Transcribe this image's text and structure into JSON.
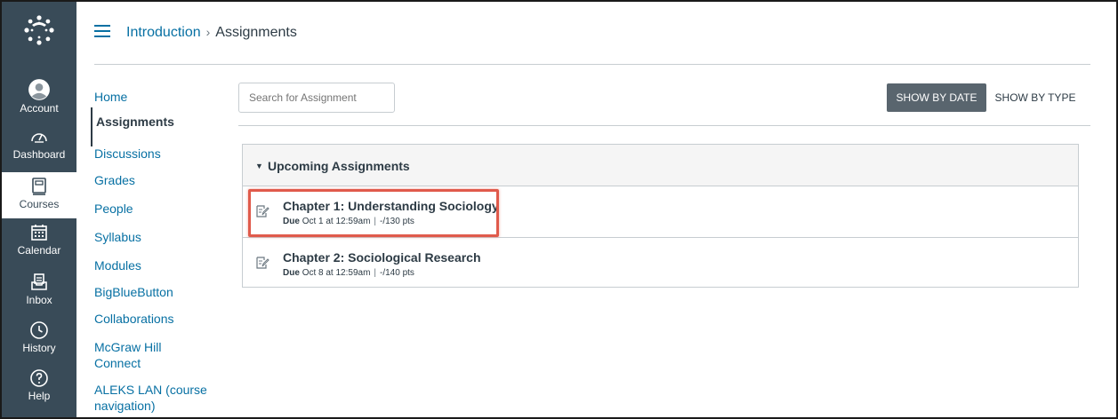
{
  "global_nav": {
    "items": [
      {
        "label": "Account",
        "icon": "account-icon"
      },
      {
        "label": "Dashboard",
        "icon": "dashboard-icon"
      },
      {
        "label": "Courses",
        "icon": "courses-icon"
      },
      {
        "label": "Calendar",
        "icon": "calendar-icon"
      },
      {
        "label": "Inbox",
        "icon": "inbox-icon"
      },
      {
        "label": "History",
        "icon": "history-icon"
      },
      {
        "label": "Help",
        "icon": "help-icon"
      }
    ],
    "active": "Courses",
    "colors": {
      "bg": "#394b58",
      "active_bg": "#ffffff"
    }
  },
  "breadcrumb": {
    "course": "Introduction",
    "separator": "›",
    "current": "Assignments"
  },
  "course_nav": {
    "items": [
      {
        "label": "Home"
      },
      {
        "label": "Assignments",
        "active": true
      },
      {
        "label": "Discussions"
      },
      {
        "label": "Grades"
      },
      {
        "label": "People"
      },
      {
        "label": "Syllabus"
      },
      {
        "label": "Modules"
      },
      {
        "label": "BigBlueButton"
      },
      {
        "label": "Collaborations"
      },
      {
        "label": "McGraw Hill\nConnect"
      },
      {
        "label": "ALEKS LAN (course\nnavigation)"
      }
    ]
  },
  "toolbar": {
    "search_placeholder": "Search for Assignment",
    "show_by_date": "SHOW BY DATE",
    "show_by_type": "SHOW BY TYPE"
  },
  "assignment_group": {
    "title": "Upcoming Assignments",
    "items": [
      {
        "title": "Chapter 1: Understanding Sociology",
        "due_label": "Due",
        "due": "Oct 1 at 12:59am",
        "points": "-/130 pts",
        "highlighted": true
      },
      {
        "title": "Chapter 2: Sociological Research",
        "due_label": "Due",
        "due": "Oct 8 at 12:59am",
        "points": "-/140 pts",
        "highlighted": false
      }
    ]
  },
  "colors": {
    "link": "#0770a3",
    "text": "#2d3b45",
    "highlight": "#e05a4b"
  }
}
